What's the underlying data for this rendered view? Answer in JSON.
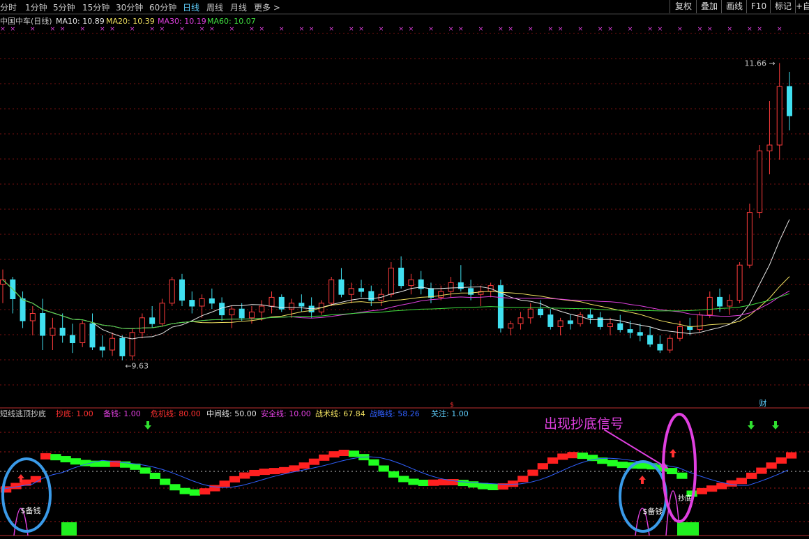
{
  "timeframes": [
    "分时",
    "1分钟",
    "5分钟",
    "15分钟",
    "30分钟",
    "60分钟",
    "日线",
    "周线",
    "月线",
    "更多 >"
  ],
  "active_timeframe": "日线",
  "toolbar_buttons": [
    "复权",
    "叠加",
    "画线",
    "F10",
    "标记",
    "+自"
  ],
  "main_legend": [
    {
      "text": "中国中车(日线)",
      "color": "#c8c8c8"
    },
    {
      "text": "MA10: 10.89",
      "color": "#e8e8e8"
    },
    {
      "text": "MA20: 10.39",
      "color": "#f0e060"
    },
    {
      "text": "MA30: 10.19",
      "color": "#e040e0"
    },
    {
      "text": "MA60: 10.07",
      "color": "#40e040"
    }
  ],
  "price_high_label": "11.66",
  "price_low_label": "9.63",
  "markers": {
    "caitext": "财",
    "dollar": "$"
  },
  "sub_legend": [
    {
      "text": "短线逃顶抄底",
      "color": "#c8c8c8"
    },
    {
      "text": "抄底: 1.00",
      "color": "#ff3030"
    },
    {
      "text": "备钱: 1.00",
      "color": "#e040e0"
    },
    {
      "text": "危机线: 80.00",
      "color": "#ff3030"
    },
    {
      "text": "中间线: 50.00",
      "color": "#e8e8e8"
    },
    {
      "text": "安全线: 10.00",
      "color": "#e040e0"
    },
    {
      "text": "战术线: 67.84",
      "color": "#f0e060"
    },
    {
      "text": "战略线: 58.26",
      "color": "#3060ff"
    },
    {
      "text": "关注: 1.00",
      "color": "#5fd0ff"
    }
  ],
  "annotation": "出现抄底信号",
  "sub_labels": {
    "beiqian": "$备钱",
    "chaodi": "抄底"
  },
  "colors": {
    "up": "#ff3c3c",
    "down": "#40e0f0",
    "grid": "#7a1010",
    "ma10": "#e8e8e8",
    "ma20": "#f0e060",
    "ma30": "#e040e0",
    "ma60": "#40e040",
    "annotation": "#e040e0",
    "circle": "#3a9ae8"
  },
  "chart_data": {
    "type": "candlestick",
    "title": "中国中车(日线)",
    "price_range": [
      9.4,
      11.9
    ],
    "highest": 11.66,
    "lowest": 9.63,
    "candles_ohlc": [
      [
        10.15,
        10.25,
        10.02,
        10.18
      ],
      [
        10.18,
        10.2,
        9.95,
        10.05
      ],
      [
        10.05,
        10.1,
        9.85,
        9.9
      ],
      [
        9.9,
        10.0,
        9.8,
        9.95
      ],
      [
        9.95,
        10.05,
        9.7,
        9.8
      ],
      [
        9.8,
        9.92,
        9.7,
        9.85
      ],
      [
        9.85,
        9.95,
        9.75,
        9.8
      ],
      [
        9.8,
        9.88,
        9.68,
        9.75
      ],
      [
        9.75,
        9.9,
        9.72,
        9.88
      ],
      [
        9.88,
        9.95,
        9.7,
        9.72
      ],
      [
        9.72,
        9.8,
        9.65,
        9.7
      ],
      [
        9.7,
        9.82,
        9.66,
        9.78
      ],
      [
        9.78,
        9.8,
        9.63,
        9.66
      ],
      [
        9.66,
        9.85,
        9.63,
        9.82
      ],
      [
        9.82,
        9.95,
        9.78,
        9.92
      ],
      [
        9.92,
        10.0,
        9.85,
        9.88
      ],
      [
        9.88,
        10.05,
        9.86,
        10.02
      ],
      [
        10.02,
        10.2,
        10.0,
        10.18
      ],
      [
        10.18,
        10.22,
        10.0,
        10.04
      ],
      [
        10.04,
        10.1,
        9.95,
        10.0
      ],
      [
        10.0,
        10.08,
        9.92,
        10.05
      ],
      [
        10.05,
        10.12,
        9.98,
        10.02
      ],
      [
        10.02,
        10.06,
        9.9,
        9.94
      ],
      [
        9.94,
        10.0,
        9.85,
        9.98
      ],
      [
        9.98,
        10.02,
        9.9,
        9.92
      ],
      [
        9.92,
        10.0,
        9.88,
        9.96
      ],
      [
        9.96,
        10.04,
        9.9,
        10.0
      ],
      [
        10.0,
        10.1,
        9.95,
        10.06
      ],
      [
        10.06,
        10.08,
        9.96,
        9.98
      ],
      [
        9.98,
        10.05,
        9.92,
        10.02
      ],
      [
        10.02,
        10.08,
        9.96,
        10.0
      ],
      [
        10.0,
        10.06,
        9.92,
        9.96
      ],
      [
        9.96,
        10.04,
        9.94,
        10.02
      ],
      [
        10.02,
        10.2,
        10.0,
        10.18
      ],
      [
        10.18,
        10.26,
        10.06,
        10.08
      ],
      [
        10.08,
        10.16,
        10.02,
        10.12
      ],
      [
        10.12,
        10.18,
        10.06,
        10.1
      ],
      [
        10.1,
        10.14,
        10.0,
        10.04
      ],
      [
        10.04,
        10.12,
        10.0,
        10.08
      ],
      [
        10.08,
        10.3,
        10.06,
        10.26
      ],
      [
        10.26,
        10.34,
        10.12,
        10.14
      ],
      [
        10.14,
        10.22,
        10.08,
        10.18
      ],
      [
        10.18,
        10.24,
        10.08,
        10.12
      ],
      [
        10.12,
        10.16,
        10.02,
        10.06
      ],
      [
        10.06,
        10.14,
        10.04,
        10.1
      ],
      [
        10.1,
        10.2,
        10.06,
        10.16
      ],
      [
        10.16,
        10.28,
        10.1,
        10.12
      ],
      [
        10.12,
        10.18,
        10.04,
        10.08
      ],
      [
        10.08,
        10.14,
        10.0,
        10.1
      ],
      [
        10.1,
        10.16,
        10.06,
        10.14
      ],
      [
        10.14,
        10.18,
        9.82,
        9.85
      ],
      [
        9.85,
        9.9,
        9.8,
        9.88
      ],
      [
        9.88,
        9.96,
        9.84,
        9.92
      ],
      [
        9.92,
        10.02,
        9.88,
        9.98
      ],
      [
        9.98,
        10.04,
        9.92,
        9.94
      ],
      [
        9.94,
        9.98,
        9.84,
        9.86
      ],
      [
        9.86,
        9.92,
        9.8,
        9.9
      ],
      [
        9.9,
        9.94,
        9.84,
        9.88
      ],
      [
        9.88,
        9.96,
        9.86,
        9.94
      ],
      [
        9.94,
        9.98,
        9.88,
        9.92
      ],
      [
        9.92,
        9.96,
        9.84,
        9.86
      ],
      [
        9.86,
        9.92,
        9.8,
        9.88
      ],
      [
        9.88,
        9.94,
        9.82,
        9.84
      ],
      [
        9.84,
        9.9,
        9.78,
        9.82
      ],
      [
        9.82,
        9.88,
        9.76,
        9.8
      ],
      [
        9.8,
        9.86,
        9.72,
        9.74
      ],
      [
        9.74,
        9.8,
        9.68,
        9.7
      ],
      [
        9.7,
        9.8,
        9.68,
        9.78
      ],
      [
        9.78,
        9.9,
        9.76,
        9.86
      ],
      [
        9.86,
        9.92,
        9.8,
        9.84
      ],
      [
        9.84,
        9.96,
        9.82,
        9.94
      ],
      [
        9.94,
        10.1,
        9.92,
        10.06
      ],
      [
        10.06,
        10.12,
        9.96,
        10.0
      ],
      [
        10.0,
        10.08,
        9.94,
        10.04
      ],
      [
        10.04,
        10.3,
        10.02,
        10.28
      ],
      [
        10.28,
        10.7,
        10.26,
        10.64
      ],
      [
        10.64,
        11.1,
        10.6,
        11.06
      ],
      [
        11.06,
        11.4,
        10.9,
        11.1
      ],
      [
        11.1,
        11.66,
        11.0,
        11.5
      ],
      [
        11.5,
        11.6,
        11.2,
        11.3
      ]
    ]
  }
}
